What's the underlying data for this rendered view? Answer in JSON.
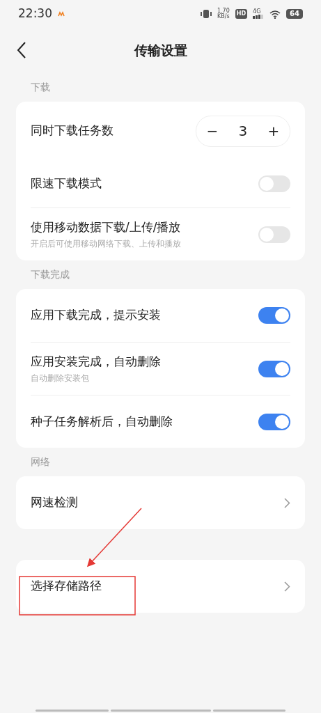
{
  "status_bar": {
    "time": "22:30",
    "speed_value": "1.70",
    "speed_unit": "KB/s",
    "hd": "HD",
    "network": "4G",
    "battery": "64"
  },
  "header": {
    "title": "传输设置"
  },
  "sections": [
    {
      "title": "下载",
      "items": [
        {
          "kind": "stepper",
          "label": "同时下载任务数",
          "value": "3",
          "minus": "−",
          "plus": "+"
        },
        {
          "kind": "toggle",
          "label": "限速下载模式",
          "on": false
        },
        {
          "kind": "toggle",
          "label": "使用移动数据下载/上传/播放",
          "subtitle": "开启后可使用移动网络下载、上传和播放",
          "on": false
        }
      ]
    },
    {
      "title": "下载完成",
      "items": [
        {
          "kind": "toggle",
          "label": "应用下载完成，提示安装",
          "on": true
        },
        {
          "kind": "toggle",
          "label": "应用安装完成，自动删除",
          "subtitle": "自动删除安装包",
          "on": true
        },
        {
          "kind": "toggle",
          "label": "种子任务解析后，自动删除",
          "on": true
        }
      ]
    },
    {
      "title": "网络",
      "items": [
        {
          "kind": "link",
          "label": "网速检测"
        }
      ]
    },
    {
      "items": [
        {
          "kind": "link",
          "label": "选择存储路径"
        }
      ]
    }
  ]
}
